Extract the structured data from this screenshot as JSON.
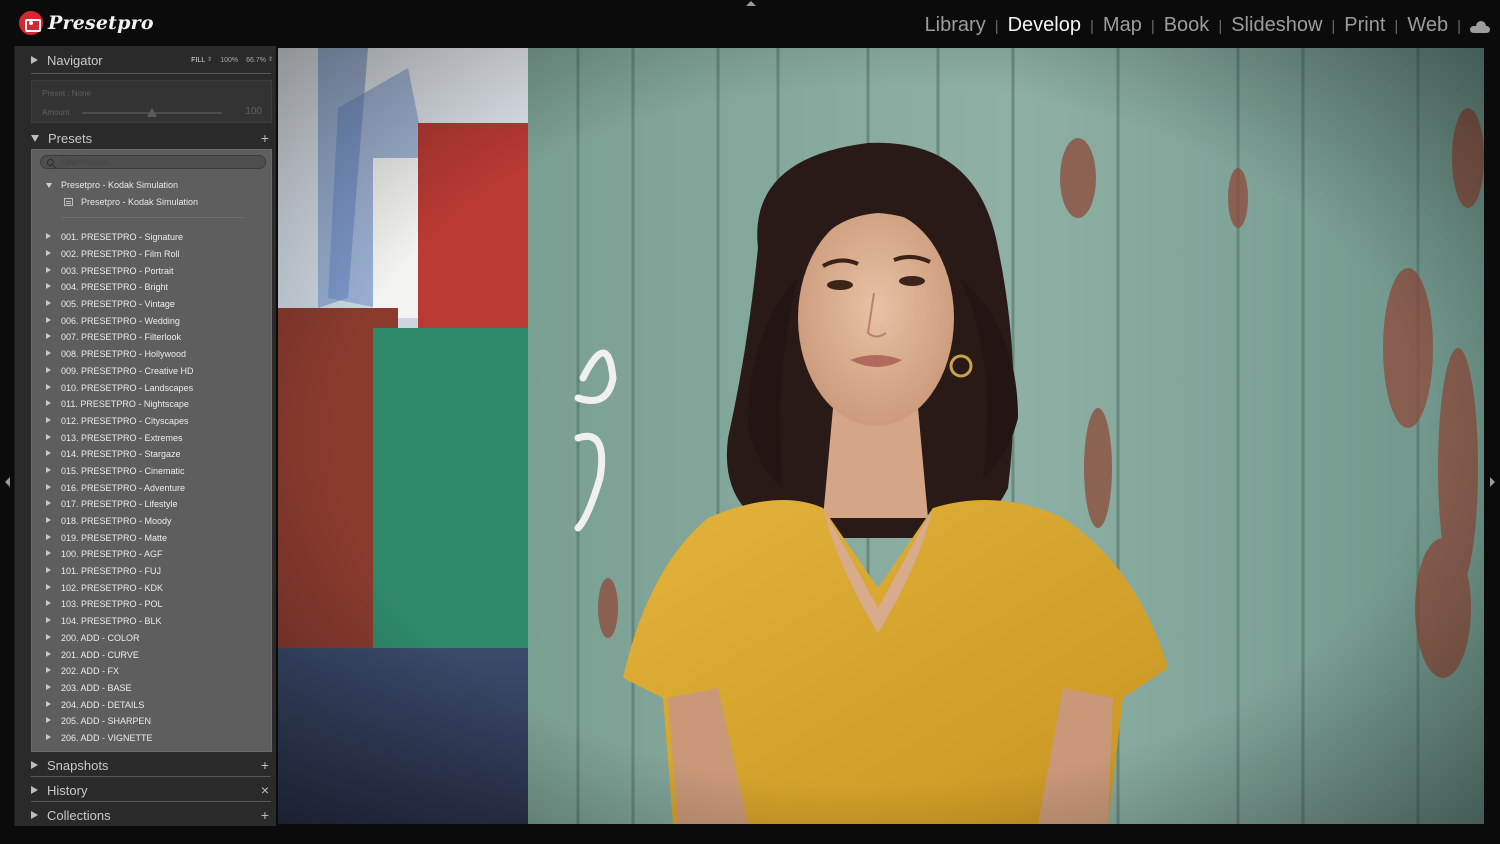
{
  "app": {
    "logo_text": "Presetpro",
    "modules": [
      "Library",
      "Develop",
      "Map",
      "Book",
      "Slideshow",
      "Print",
      "Web"
    ],
    "active_module": "Develop",
    "cloud_icon": "cloud-icon"
  },
  "navigator": {
    "title": "Navigator",
    "options": [
      "FILL",
      "100%",
      "66.7%"
    ],
    "selected_option": "FILL"
  },
  "preset_amount": {
    "preset_label": "Preset : None",
    "amount_label": "Amount",
    "amount_value": "100",
    "amount_fraction": 0.5
  },
  "presets": {
    "title": "Presets",
    "add_label": "+",
    "filter_placeholder": "Filter Presets",
    "group_name": "Presetpro - Kodak Simulation",
    "group_item": "Presetpro - Kodak Simulation",
    "folders": [
      "001. PRESETPRO - Signature",
      "002. PRESETPRO - Film Roll",
      "003. PRESETPRO - Portrait",
      "004. PRESETPRO - Bright",
      "005. PRESETPRO - Vintage",
      "006. PRESETPRO - Wedding",
      "007. PRESETPRO - Filterlook",
      "008. PRESETPRO - Hollywood",
      "009. PRESETPRO - Creative HD",
      "010. PRESETPRO - Landscapes",
      "011. PRESETPRO - Nightscape",
      "012. PRESETPRO - Cityscapes",
      "013. PRESETPRO - Extremes",
      "014. PRESETPRO - Stargaze",
      "015. PRESETPRO - Cinematic",
      "016. PRESETPRO - Adventure",
      "017. PRESETPRO - Lifestyle",
      "018. PRESETPRO - Moody",
      "019. PRESETPRO - Matte",
      "100. PRESETPRO - AGF",
      "101. PRESETPRO - FUJ",
      "102. PRESETPRO - KDK",
      "103. PRESETPRO - POL",
      "104. PRESETPRO - BLK",
      "200. ADD - COLOR",
      "201. ADD - CURVE",
      "202. ADD - FX",
      "203. ADD - BASE",
      "204. ADD - DETAILS",
      "205. ADD - SHARPEN",
      "206. ADD - VIGNETTE"
    ]
  },
  "snapshots": {
    "title": "Snapshots",
    "action": "+"
  },
  "history": {
    "title": "History",
    "action": "×"
  },
  "collections": {
    "title": "Collections",
    "action": "+"
  },
  "photo": {
    "description_icon": "photo-portrait"
  },
  "colors": {
    "background": "#0b0b0c",
    "panel": "#2a2a2a",
    "presets_list_bg": "#5e5e5e",
    "brand_red": "#d7262f",
    "active_module": "#f5f5f5",
    "inactive_module": "#9c9c9c"
  }
}
